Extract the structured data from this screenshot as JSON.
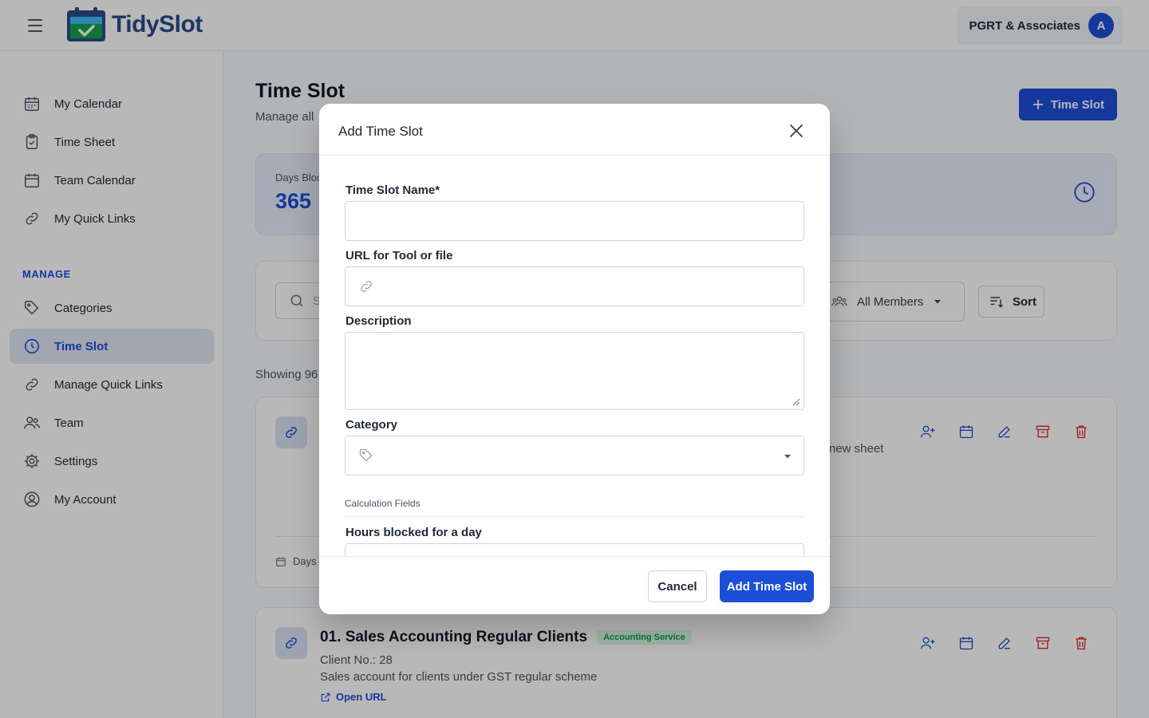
{
  "app": {
    "brand": "TidySlot",
    "brand_colors": {
      "primary": "#1d4ed8",
      "logo_blue": "#2b4a8c",
      "logo_green": "#16a34a"
    }
  },
  "header": {
    "menu_icon": "hamburger-icon",
    "account_name": "PGRT & Associates",
    "avatar_initial": "A"
  },
  "sidebar": {
    "items": [
      {
        "label": "My Calendar",
        "icon": "calendar-icon"
      },
      {
        "label": "Time Sheet",
        "icon": "clipboard-check-icon"
      },
      {
        "label": "Team Calendar",
        "icon": "calendar-icon"
      },
      {
        "label": "My Quick Links",
        "icon": "link-icon"
      }
    ],
    "manage_label": "MANAGE",
    "manage_items": [
      {
        "label": "Categories",
        "icon": "tag-icon"
      },
      {
        "label": "Time Slot",
        "icon": "clock-icon",
        "active": true
      },
      {
        "label": "Manage Quick Links",
        "icon": "link-icon"
      },
      {
        "label": "Team",
        "icon": "users-icon"
      },
      {
        "label": "Settings",
        "icon": "gear-icon"
      },
      {
        "label": "My Account",
        "icon": "user-circle-icon"
      }
    ]
  },
  "page": {
    "title": "Time Slot",
    "subtitle": "Manage all",
    "add_button": "Time Slot",
    "stats": {
      "label": "Days Bloc",
      "value": "365"
    },
    "filters": {
      "search_placeholder": "S",
      "members_value": "All Members",
      "sort_label": "Sort"
    },
    "showing": "Showing 96",
    "card1": {
      "right_text": "new sheet",
      "footer_text": "Days I"
    },
    "card2": {
      "title": "01. Sales Accounting Regular Clients",
      "tag": "Accounting Service",
      "client_no": "Client No.: 28",
      "description": "Sales account for clients under GST regular scheme",
      "open_url": "Open URL"
    }
  },
  "modal": {
    "title": "Add Time Slot",
    "fields": {
      "name_label": "Time Slot Name*",
      "name_value": "",
      "url_label": "URL for Tool or file",
      "url_value": "",
      "description_label": "Description",
      "description_value": "",
      "category_label": "Category",
      "category_value": "",
      "calc_section": "Calculation Fields",
      "hours_label": "Hours blocked for a day"
    },
    "cancel_label": "Cancel",
    "submit_label": "Add Time Slot"
  }
}
